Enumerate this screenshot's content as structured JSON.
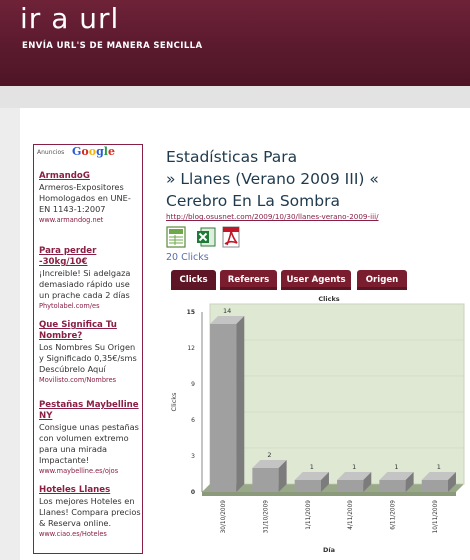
{
  "site": {
    "logo": "ir a url",
    "tagline": "ENVÍA URL'S DE MANERA SENCILLA"
  },
  "ads": {
    "label": "Anuncios",
    "provider": "Google",
    "items": [
      {
        "title": "ArmandoG",
        "desc": "Armeros-Expositores Homologados en UNE-EN 1143-1:2007",
        "url": "www.armandog.net"
      },
      {
        "title": "Para perder -30kg/10€",
        "desc": "¡Increible! Si adelgaza demasiado rápido use un prache cada 2 días",
        "url": "Phytolabel.com/es"
      },
      {
        "title": "Que Significa Tu Nombre?",
        "desc": "Los Nombres Su Origen y Significado 0,35€/sms Descúbrelo Aquí",
        "url": "Movilisto.com/Nombres"
      },
      {
        "title": "Pestañas Maybelline NY",
        "desc": "Consigue unas pestañas con volumen extremo para una mirada Impactante!",
        "url": "www.maybelline.es/ojos"
      },
      {
        "title": "Hoteles Llanes",
        "desc": "Los mejores Hoteles en Llanes! Compara precios & Reserva online.",
        "url": "www.ciao.es/Hoteles"
      }
    ]
  },
  "page": {
    "title_lines": [
      "Estadísticas Para",
      "» Llanes (Verano 2009 III) «",
      "Cerebro En La Sombra"
    ],
    "url": "http://blog.osusnet.com/2009/10/30/llanes-verano-2009-iii/",
    "clicks_text": "20 Clicks"
  },
  "export_icons": [
    "spreadsheet-icon",
    "excel-icon",
    "pdf-icon"
  ],
  "tabs": [
    {
      "label": "Clicks",
      "active": true
    },
    {
      "label": "Referers",
      "active": false
    },
    {
      "label": "User Agents",
      "active": false
    },
    {
      "label": "Origen",
      "active": false
    }
  ],
  "chart_data": {
    "type": "bar",
    "title": "Clicks",
    "xlabel": "Día",
    "ylabel": "Clicks",
    "categories": [
      "30/10/2009",
      "31/10/2009",
      "1/11/2009",
      "4/11/2009",
      "6/11/2009",
      "10/11/2009"
    ],
    "values": [
      14,
      2,
      1,
      1,
      1,
      1
    ],
    "ylim": [
      0,
      15
    ],
    "yticks": [
      0,
      3,
      6,
      9,
      12,
      15
    ],
    "colors": {
      "bar": "#a0a0a0",
      "bar_top": "#c4c4c4",
      "bar_side": "#7c7c7c",
      "wall": "#dfe8d3",
      "floor": "#9aa88a"
    }
  }
}
